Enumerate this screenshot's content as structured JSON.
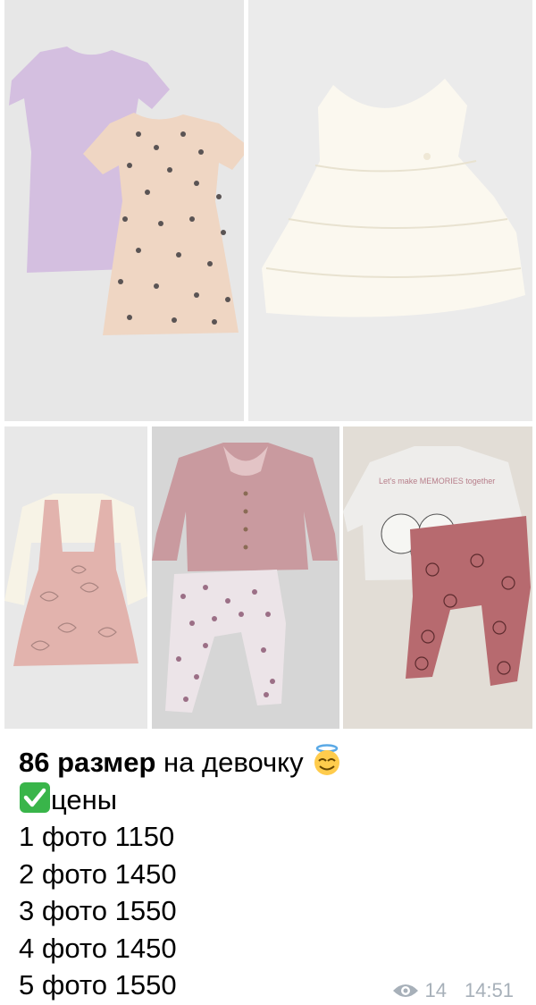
{
  "photos": [
    {
      "alt": "lilac and beige polka dot dresses"
    },
    {
      "alt": "white ruffled lace dress"
    },
    {
      "alt": "pink pinafore dress with white top"
    },
    {
      "alt": "pink blouse with floral leggings"
    },
    {
      "alt": "Winnie the Pooh sweatshirt and leggings"
    }
  ],
  "photo3_print": "Let's make MEMORIES together",
  "message": {
    "headline_bold": "86 размер",
    "headline_rest": " на девочку ",
    "prices_label": "цены",
    "lines": [
      "1 фото 1150",
      "2 фото 1450",
      "3 фото 1550",
      "4 фото 1450",
      "5 фото 1550"
    ]
  },
  "meta": {
    "views": "14",
    "time": "14:51"
  },
  "colors": {
    "check": "#39b54a",
    "meta": "#a7b0b9"
  },
  "icons": [
    "smiling-face-with-halo-icon",
    "check-mark-button-icon",
    "eye-icon"
  ]
}
